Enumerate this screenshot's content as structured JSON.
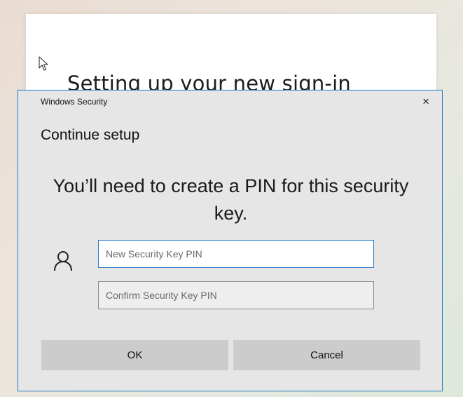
{
  "background": {
    "title": "Setting up your new sign-in"
  },
  "dialog": {
    "caption": "Windows Security",
    "close_symbol": "×",
    "heading": "Continue setup",
    "message": "You’ll need to create a PIN for this security key.",
    "user_icon": "user-icon",
    "new_pin": {
      "placeholder": "New Security Key PIN",
      "value": ""
    },
    "confirm_pin": {
      "placeholder": "Confirm Security Key PIN",
      "value": ""
    },
    "ok_label": "OK",
    "cancel_label": "Cancel"
  },
  "colors": {
    "dialog_border": "#1e79c4",
    "dialog_background": "#e6e6e6",
    "button_background": "#cccccc",
    "focused_input_border": "#2a78c8"
  }
}
